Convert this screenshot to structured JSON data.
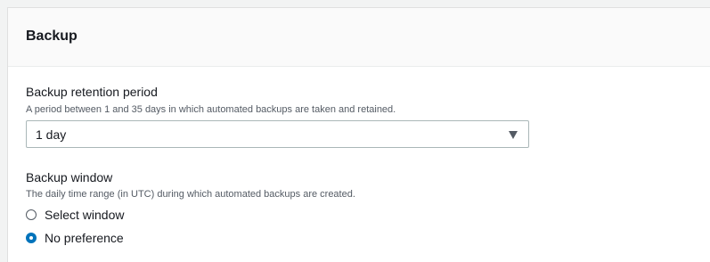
{
  "panel": {
    "title": "Backup"
  },
  "retention": {
    "label": "Backup retention period",
    "description": "A period between 1 and 35 days in which automated backups are taken and retained.",
    "selected_value": "1 day"
  },
  "window": {
    "label": "Backup window",
    "description": "The daily time range (in UTC) during which automated backups are created.",
    "options": [
      {
        "label": "Select window",
        "checked": false
      },
      {
        "label": "No preference",
        "checked": true
      }
    ]
  },
  "colors": {
    "accent": "#0073bb",
    "text": "#16191f",
    "secondary_text": "#545b64",
    "header_bg": "#fafafa"
  },
  "icons": {
    "select_caret": "caret-down-icon"
  }
}
